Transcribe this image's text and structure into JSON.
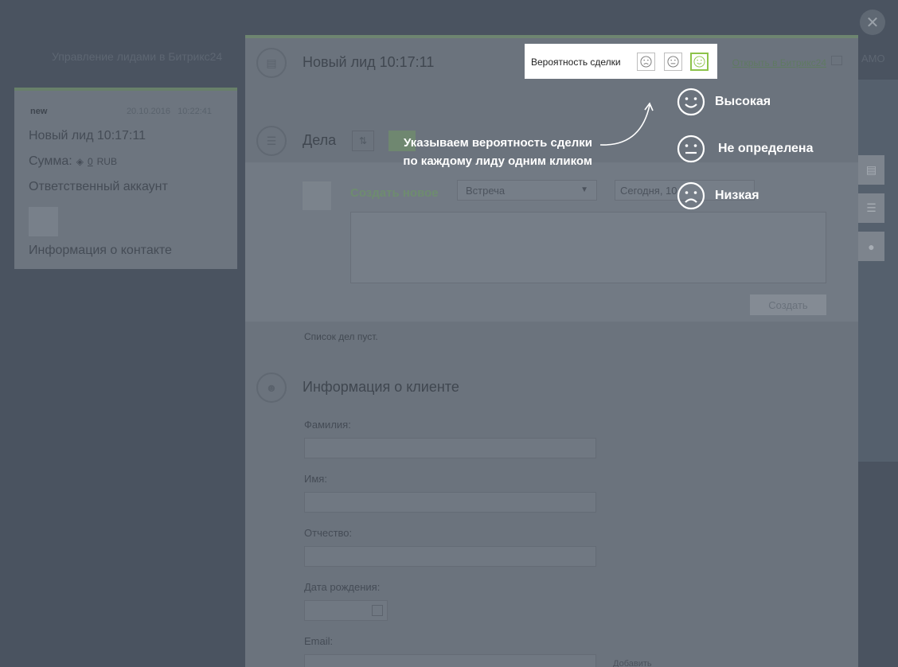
{
  "background": {
    "top_text": "Управление лидами в Битрикс24",
    "right_text": "AMO"
  },
  "lead_card": {
    "status": "new",
    "date": "20.10.2016",
    "time": "10:22:41",
    "title": "Новый лид 10:17:11",
    "sum_label": "Сумма:",
    "sum_value": "0",
    "currency": "RUB",
    "responsible": "Ответственный аккаунт",
    "contact_info": "Информация о контакте"
  },
  "panel": {
    "title": "Новый лид 10:17:11",
    "open_link": "Открыть в Битрикс24",
    "deals_title": "Дела",
    "create_new": "Создать новое",
    "activity_type": "Встреча",
    "date_value": "Сегодня, 10",
    "submit": "Создать",
    "empty_list": "Список дел пуст.",
    "client_title": "Информация о клиенте",
    "fields": {
      "last_name": "Фамилия:",
      "first_name": "Имя:",
      "middle_name": "Отчество:",
      "birth_date": "Дата рождения:",
      "email": "Email:"
    },
    "add_link": "Добавить"
  },
  "probability": {
    "label": "Вероятность сделки",
    "selected": "high",
    "accent_color": "#8dc34a"
  },
  "annotation": {
    "text_line1": "Указываем вероятность сделки",
    "text_line2": "по каждому лиду одним кликом",
    "legend": [
      {
        "icon": "smile-icon",
        "label": "Высокая"
      },
      {
        "icon": "neutral-face-icon",
        "label": "Не определена"
      },
      {
        "icon": "frown-icon",
        "label": "Низкая"
      }
    ]
  },
  "close_icon": "close-icon"
}
